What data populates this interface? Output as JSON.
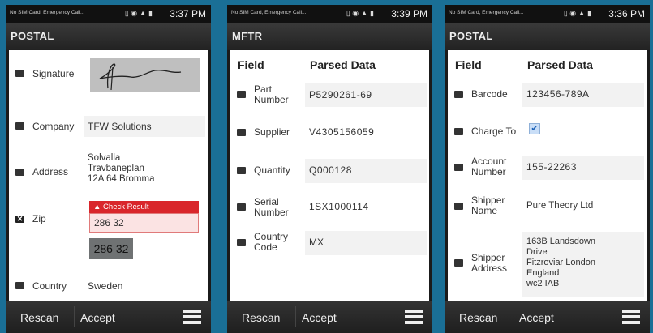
{
  "status_text": "No SIM Card, Emergency Call...",
  "status_text_short": "No SIM Card, Emergency Call...",
  "colors": {
    "background": "#1a6f96",
    "alert": "#d9262b",
    "bar": "#2a2a2a"
  },
  "screens": [
    {
      "time": "3:37 PM",
      "title": "POSTAL",
      "signature_label": "Signature",
      "rows": [
        {
          "label": "Company",
          "value": "TFW Solutions"
        },
        {
          "label": "Address",
          "value": "Solvalla\nTravbaneplan\n12A 64 Bromma"
        },
        {
          "label": "Zip",
          "alert": "Check Result",
          "value": "286 32",
          "image_text": "286 32"
        },
        {
          "label": "Country",
          "value": "Sweden"
        }
      ]
    },
    {
      "time": "3:39 PM",
      "title": "MFTR",
      "header_field": "Field",
      "header_parsed": "Parsed Data",
      "rows": [
        {
          "label": "Part\nNumber",
          "value": "P5290261-69"
        },
        {
          "label": "Supplier",
          "value": "V4305156059"
        },
        {
          "label": "Quantity",
          "value": "Q000128"
        },
        {
          "label": "Serial\nNumber",
          "value": "1SX1000114"
        },
        {
          "label": "Country\nCode",
          "value": "MX"
        }
      ]
    },
    {
      "time": "3:36 PM",
      "title": "POSTAL",
      "header_field": "Field",
      "header_parsed": "Parsed Data",
      "rows": [
        {
          "label": "Barcode",
          "value": "123456-789A"
        },
        {
          "label": "Charge To",
          "value": ""
        },
        {
          "label": "Account\nNumber",
          "value": "155-22263"
        },
        {
          "label": "Shipper\nName",
          "value": "Pure Theory Ltd"
        },
        {
          "label": "Shipper\nAddress",
          "value": "163B Landsdown\nDrive\nFitzroviar London\nEngland\nwc2 IAB"
        }
      ]
    }
  ],
  "buttons": {
    "rescan": "Rescan",
    "accept": "Accept"
  },
  "icons": {
    "menu": "menu-icon",
    "checkbox": "checkbox-icon",
    "warning": "warning-icon",
    "check": "check-icon"
  }
}
